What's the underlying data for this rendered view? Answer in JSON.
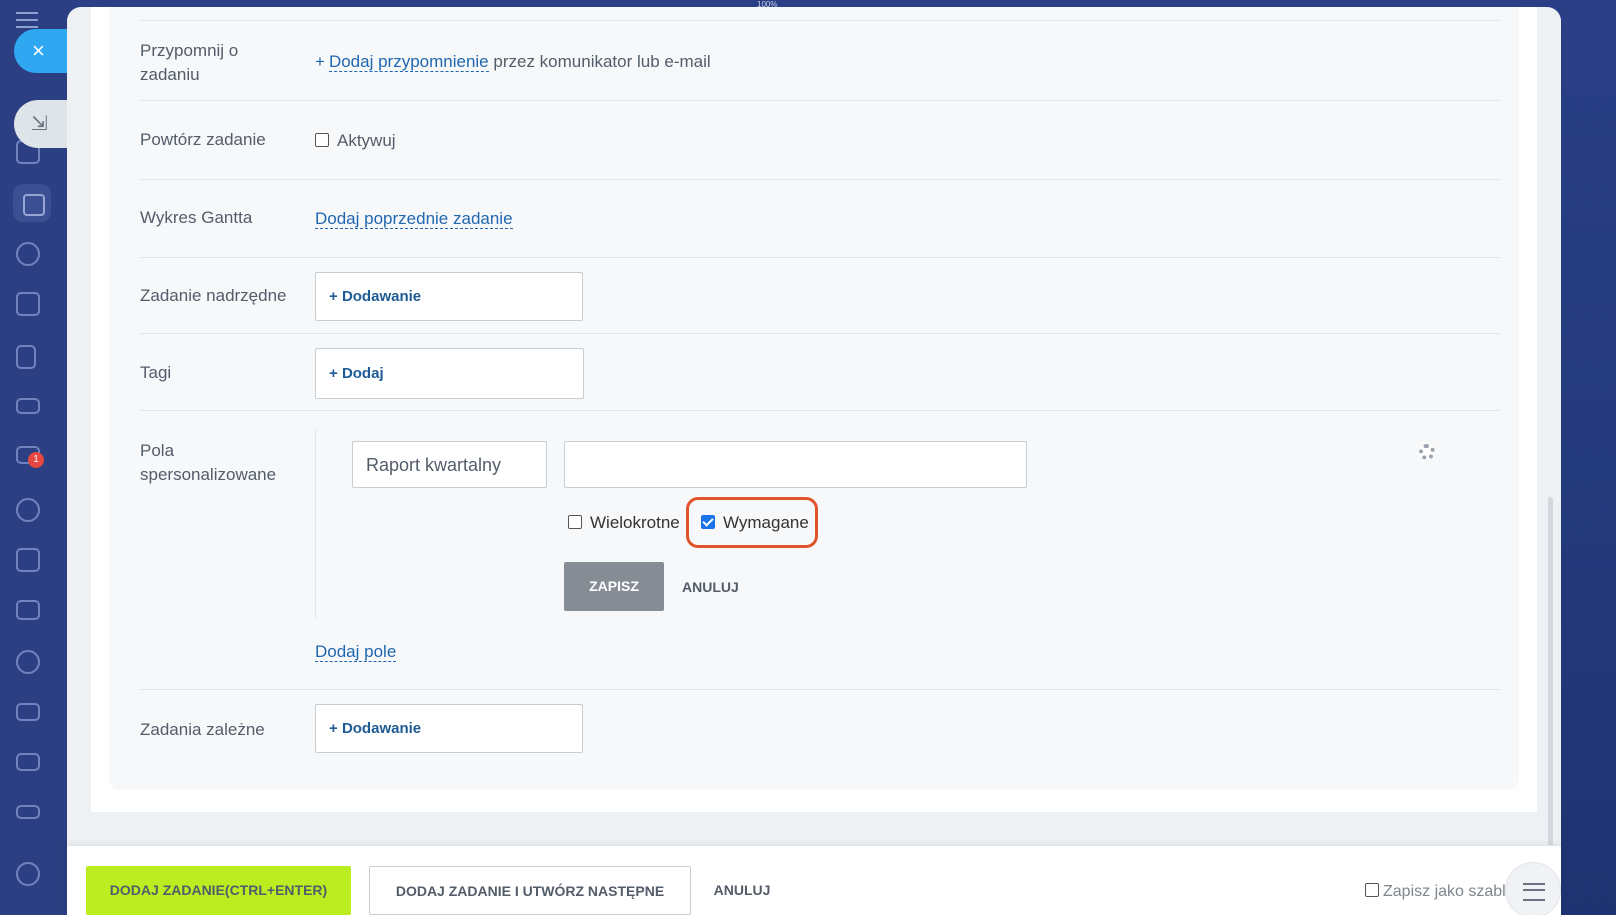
{
  "sidebar": {
    "mail_badge": "1"
  },
  "panel": {
    "zoom": "100%",
    "close_icon": "×",
    "minimize_icon": "⇲"
  },
  "form": {
    "reminder": {
      "label": "Przypomnij o zadaniu",
      "link": "Dodaj przypomnienie",
      "suffix": "przez komunikator lub e-mail"
    },
    "repeat": {
      "label": "Powtórz zadanie",
      "checkbox_label": "Aktywuj"
    },
    "gantt": {
      "label": "Wykres Gantta",
      "link": "Dodaj poprzednie zadanie"
    },
    "parent": {
      "label": "Zadanie nadrzędne",
      "button": "Dodawanie"
    },
    "tags": {
      "label": "Tagi",
      "button": "Dodaj"
    },
    "custom_fields": {
      "label": "Pola spersonalizowane",
      "name_value": "Raport kwartalny",
      "value_field": "",
      "multiple_label": "Wielokrotne",
      "multiple_checked": false,
      "required_label": "Wymagane",
      "required_checked": true,
      "save": "ZAPISZ",
      "cancel": "ANULUJ",
      "add_field": "Dodaj pole"
    },
    "dependent": {
      "label": "Zadania zależne",
      "button": "Dodawanie"
    }
  },
  "footer": {
    "add_task": "DODAJ ZADANIE(CTRL+ENTER)",
    "add_and_next": "DODAJ ZADANIE I UTWÓRZ NASTĘPNE",
    "cancel": "ANULUJ",
    "save_template": "Zapisz jako szablon"
  }
}
